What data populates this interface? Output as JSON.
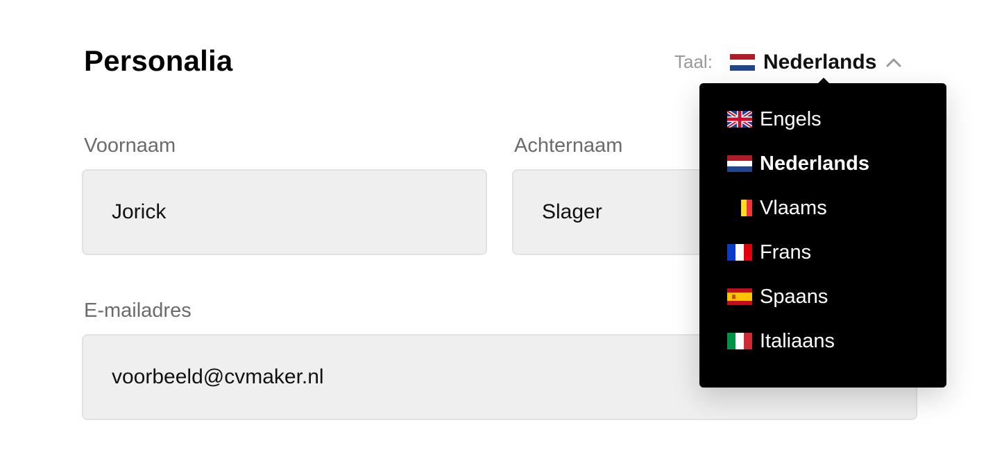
{
  "section": {
    "title": "Personalia"
  },
  "language": {
    "label": "Taal:",
    "current": "Nederlands",
    "options": [
      {
        "label": "Engels",
        "flag": "uk-flag-icon"
      },
      {
        "label": "Nederlands",
        "flag": "netherlands-flag-icon",
        "selected": true
      },
      {
        "label": "Vlaams",
        "flag": "belgium-flag-icon"
      },
      {
        "label": "Frans",
        "flag": "france-flag-icon"
      },
      {
        "label": "Spaans",
        "flag": "spain-flag-icon"
      },
      {
        "label": "Italiaans",
        "flag": "italy-flag-icon"
      }
    ]
  },
  "form": {
    "first_name": {
      "label": "Voornaam",
      "value": "Jorick"
    },
    "last_name": {
      "label": "Achternaam",
      "value": "Slager"
    },
    "email": {
      "label": "E-mailadres",
      "value": "voorbeeld@cvmaker.nl"
    }
  },
  "colors": {
    "dropdown_bg": "#000000",
    "input_bg": "#efefef",
    "label_gray": "#6b6b6b"
  }
}
